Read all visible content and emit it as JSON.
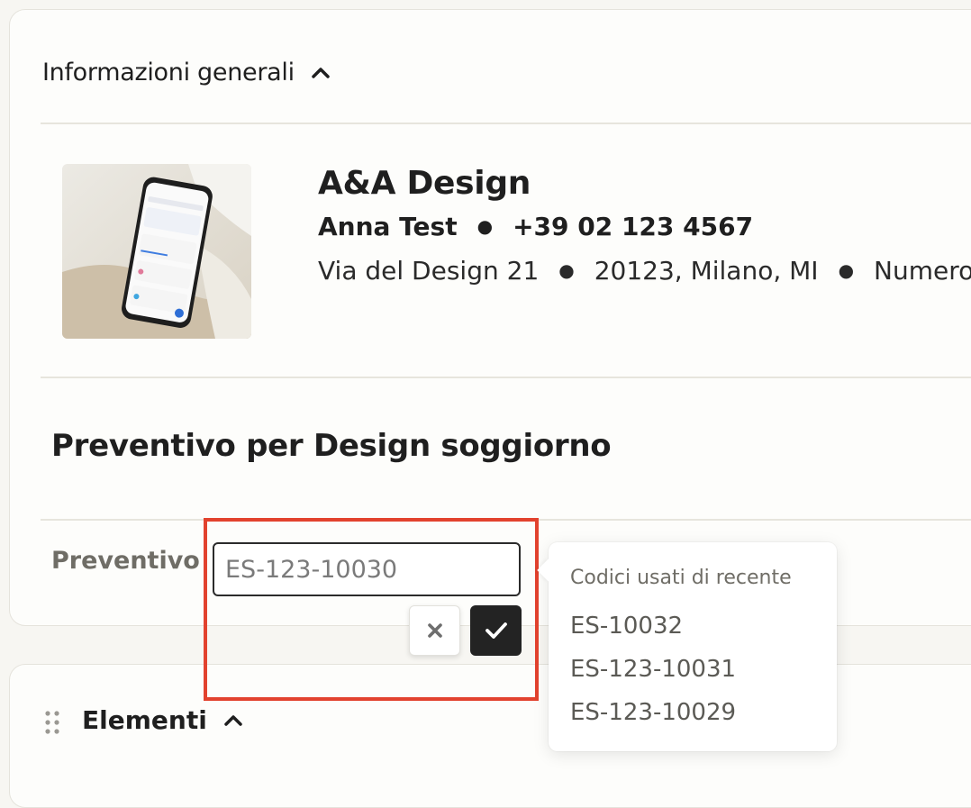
{
  "general_section": {
    "title": "Informazioni generali",
    "company": {
      "name": "A&A Design",
      "contact_name": "Anna Test",
      "phone": "+39 02 123 4567",
      "street": "Via del Design 21",
      "city": "20123, Milano, MI",
      "extra": "Numero d"
    },
    "quote_title": "Preventivo per Design soggiorno",
    "quote_field": {
      "label": "Preventivo",
      "value": "ES-123-10030"
    }
  },
  "recent_codes": {
    "title": "Codici usati di recente",
    "items": [
      "ES-10032",
      "ES-123-10031",
      "ES-123-10029"
    ]
  },
  "elements_section": {
    "title": "Elementi"
  },
  "colors": {
    "highlight": "#e2422e",
    "confirm_button": "#232323"
  },
  "icons": [
    "chevron-up-icon",
    "close-icon",
    "check-icon",
    "drag-handle-icon",
    "company-photo"
  ]
}
